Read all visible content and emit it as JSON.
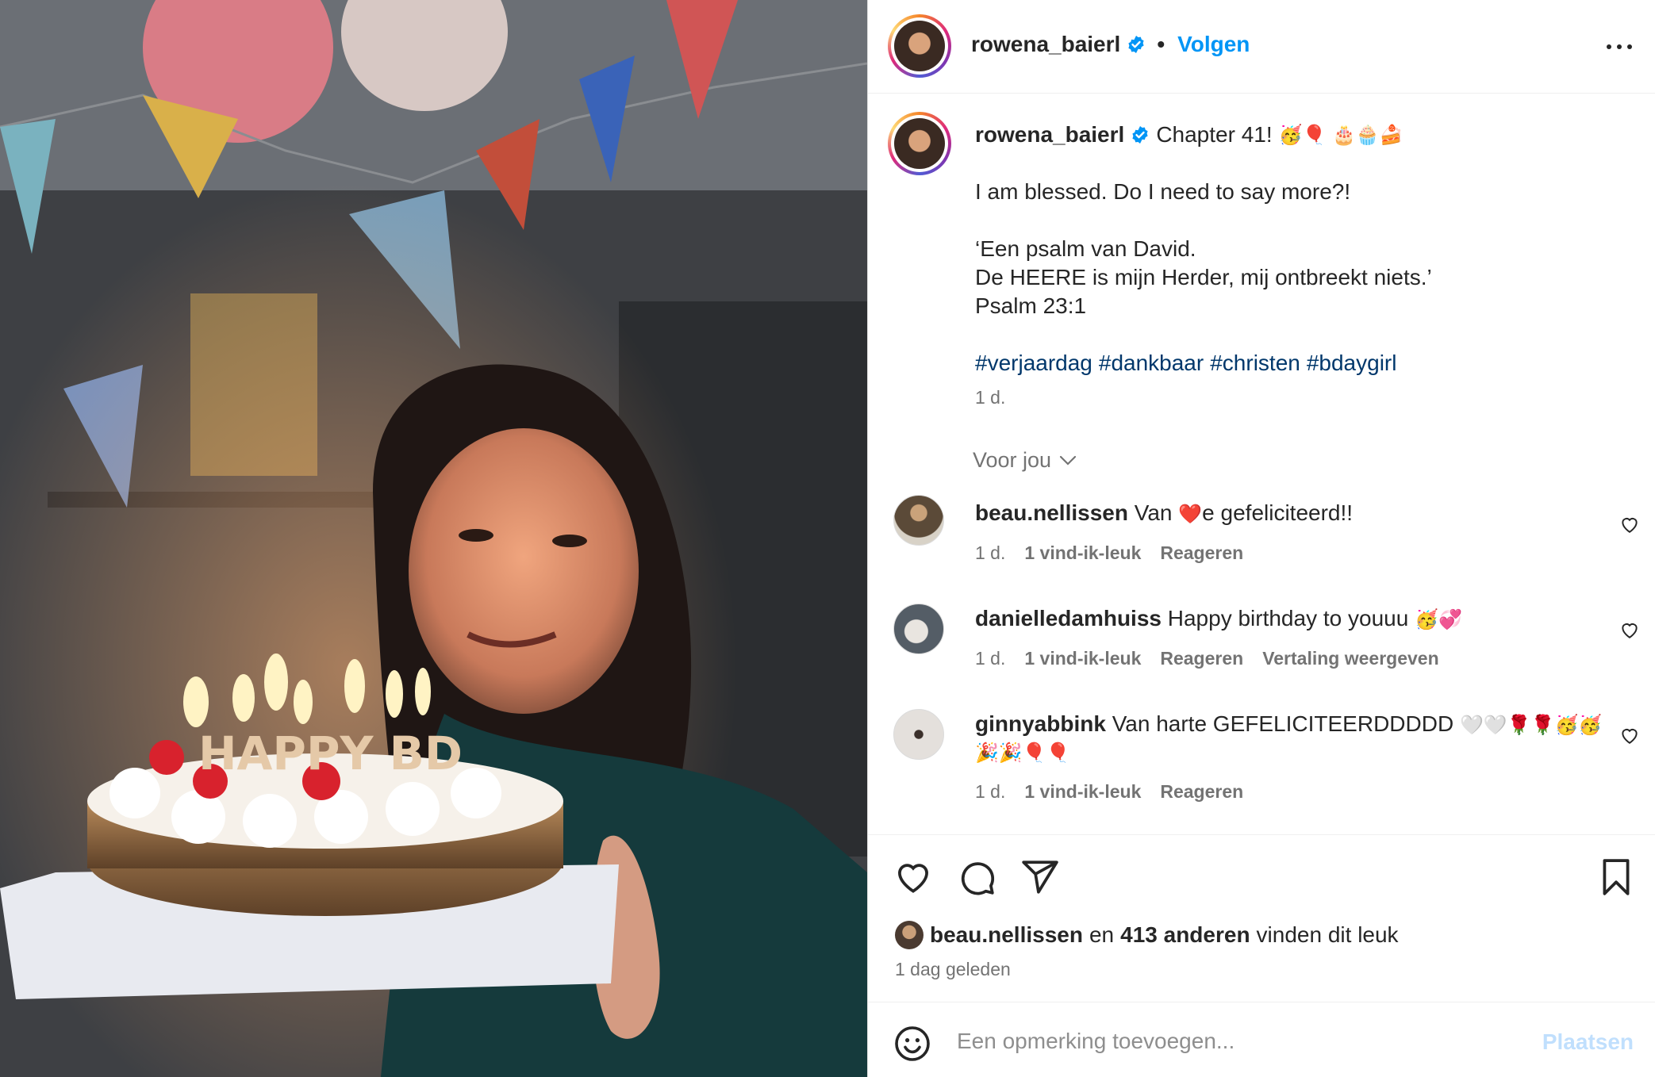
{
  "header": {
    "username": "rowena_baierl",
    "separator": "•",
    "follow_label": "Volgen"
  },
  "caption": {
    "username": "rowena_baierl",
    "title": "Chapter 41!",
    "title_emojis": "🥳🎈 🎂🧁🍰",
    "body": "I am blessed. Do I need to say more?!\n\n‘Een psalm van David.\nDe HEERE is mijn Herder, mij ontbreekt niets.’\nPsalm 23:1",
    "hashtags": [
      "#verjaardag",
      "#dankbaar",
      "#christen",
      "#bdaygirl"
    ],
    "time": "1 d."
  },
  "for_you": "Voor jou",
  "comments": [
    {
      "username": "beau.nellissen",
      "text_before": "Van ",
      "emoji": "❤️",
      "text_after": "e gefeliciteerd!!",
      "time": "1 d.",
      "likes": "1 vind-ik-leuk",
      "reply": "Reageren",
      "translate": ""
    },
    {
      "username": "danielledamhuiss",
      "text_before": "Happy birthday to youuu ",
      "emoji": "🥳💞",
      "text_after": "",
      "time": "1 d.",
      "likes": "1 vind-ik-leuk",
      "reply": "Reageren",
      "translate": "Vertaling weergeven"
    },
    {
      "username": "ginnyabbink",
      "text_before": "Van harte GEFELICITEERDDDDD ",
      "emoji": "🤍🤍🌹🌹🥳🥳 🎉🎉🎈🎈",
      "text_after": "",
      "time": "1 d.",
      "likes": "1 vind-ik-leuk",
      "reply": "Reageren",
      "translate": ""
    }
  ],
  "likes_bar": {
    "liker": "beau.nellissen",
    "connector": "en",
    "others": "413 anderen",
    "suffix": "vinden dit leuk",
    "when": "1 dag geleden"
  },
  "add_comment": {
    "placeholder": "Een opmerking toevoegen...",
    "post_label": "Plaatsen"
  },
  "colors": {
    "accent": "#0095f6",
    "hashtag": "#00376b",
    "muted": "#737373",
    "post_disabled": "#c0dffd"
  },
  "icons": [
    "verified-badge-icon",
    "more-options-icon",
    "chevron-down-icon",
    "heart-icon",
    "comment-icon",
    "share-icon",
    "bookmark-icon",
    "smiley-icon"
  ]
}
